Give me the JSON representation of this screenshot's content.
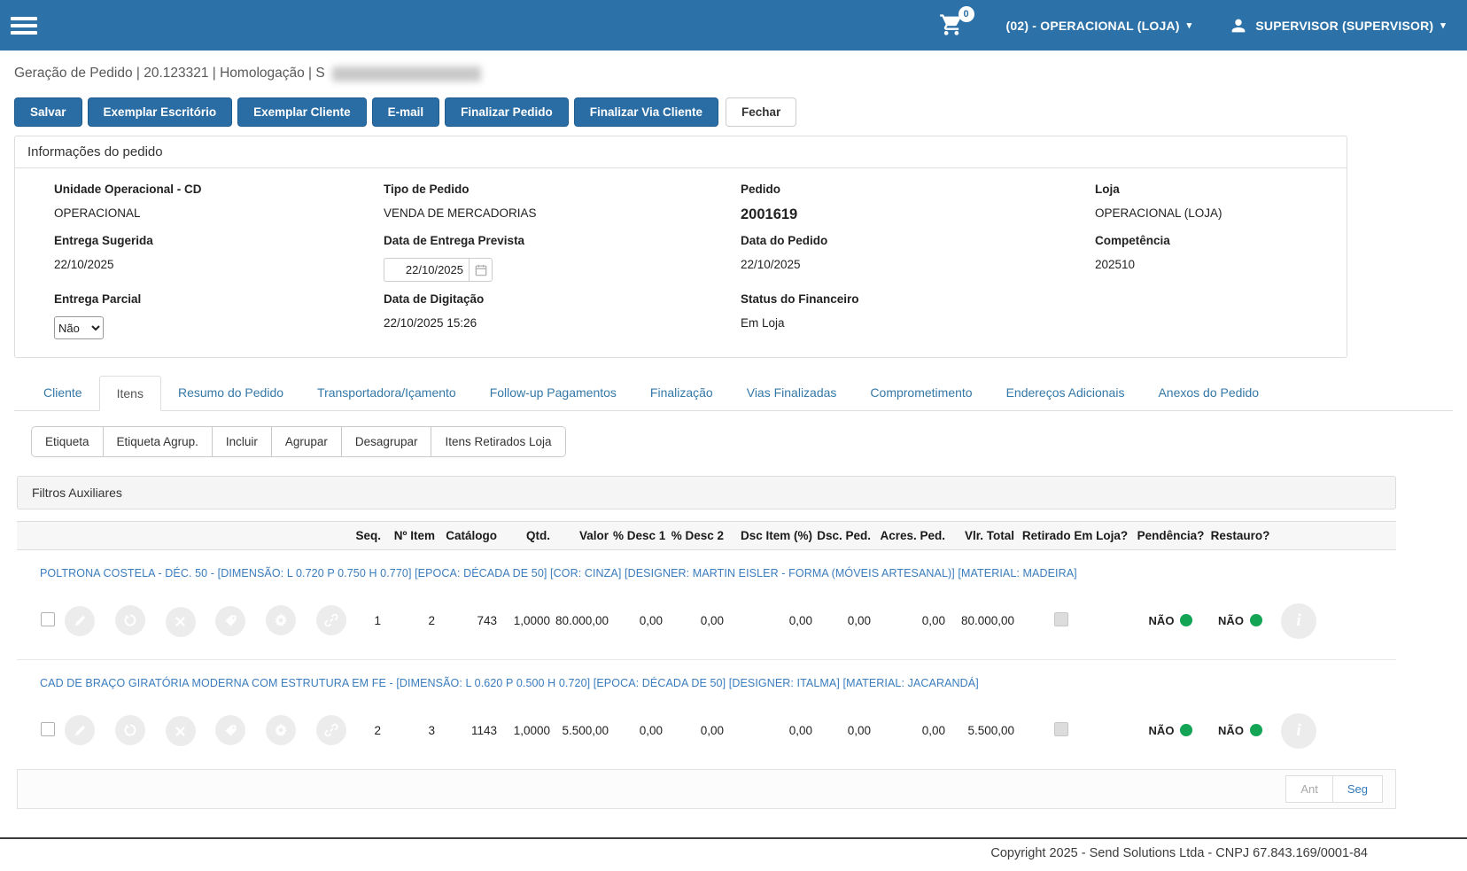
{
  "topbar": {
    "cart_count": "0",
    "unit_label": "(02) - OPERACIONAL (LOJA)",
    "user_label": "SUPERVISOR (SUPERVISOR)",
    "caret": "▾"
  },
  "header": {
    "title": "Geração de Pedido | 20.123321 | Homologação | S"
  },
  "toolbar": {
    "save": "Salvar",
    "office_copy": "Exemplar Escritório",
    "client_copy": "Exemplar Cliente",
    "email": "E-mail",
    "finalize_order": "Finalizar Pedido",
    "finalize_via_client": "Finalizar Via Cliente",
    "close": "Fechar"
  },
  "info_panel": {
    "title": "Informações do pedido",
    "fields": {
      "unit": {
        "label": "Unidade Operacional - CD",
        "value": "OPERACIONAL"
      },
      "order_type": {
        "label": "Tipo de Pedido",
        "value": "VENDA DE MERCADORIAS"
      },
      "order": {
        "label": "Pedido",
        "value": "2001619"
      },
      "store": {
        "label": "Loja",
        "value": "OPERACIONAL (LOJA)"
      },
      "suggested_delivery": {
        "label": "Entrega Sugerida",
        "value": "22/10/2025"
      },
      "expected_delivery": {
        "label": "Data de Entrega Prevista",
        "value": "22/10/2025"
      },
      "order_date": {
        "label": "Data do Pedido",
        "value": "22/10/2025"
      },
      "competence": {
        "label": "Competência",
        "value": "202510"
      },
      "partial_delivery": {
        "label": "Entrega Parcial",
        "value": "Não"
      },
      "typing_date": {
        "label": "Data de Digitação",
        "value": "22/10/2025 15:26"
      },
      "financial_status": {
        "label": "Status do Financeiro",
        "value": "Em Loja"
      }
    }
  },
  "tabs": [
    {
      "label": "Cliente"
    },
    {
      "label": "Itens",
      "active": true
    },
    {
      "label": "Resumo do Pedido"
    },
    {
      "label": "Transportadora/Içamento"
    },
    {
      "label": "Follow-up Pagamentos"
    },
    {
      "label": "Finalização"
    },
    {
      "label": "Vias Finalizadas"
    },
    {
      "label": "Comprometimento"
    },
    {
      "label": "Endereços Adicionais"
    },
    {
      "label": "Anexos do Pedido"
    }
  ],
  "items_toolbar": [
    "Etiqueta",
    "Etiqueta Agrup.",
    "Incluir",
    "Agrupar",
    "Desagrupar",
    "Itens Retirados Loja"
  ],
  "filters": {
    "title": "Filtros Auxiliares"
  },
  "table": {
    "columns": [
      "Seq.",
      "Nº Item",
      "Catálogo",
      "Qtd.",
      "Valor",
      "% Desc 1",
      "% Desc 2",
      "Dsc Item (%)",
      "Dsc. Ped.",
      "Acres. Ped.",
      "Vlr. Total",
      "Retirado Em Loja?",
      "Pendência?",
      "Restauro?"
    ],
    "rows": [
      {
        "description": "POLTRONA COSTELA - DÉC. 50 - [DIMENSÃO: L 0.720 P 0.750 H 0.770] [EPOCA: DÉCADA DE 50] [COR: CINZA] [DESIGNER: MARTIN EISLER - FORMA (MÓVEIS ARTESANAL)] [MATERIAL: MADEIRA]",
        "values": [
          "1",
          "2",
          "743",
          "1,0000",
          "80.000,00",
          "0,00",
          "0,00",
          "0,00",
          "0,00",
          "0,00",
          "80.000,00"
        ],
        "pendencia": "NÃO",
        "restauro": "NÃO"
      },
      {
        "description": "CAD DE BRAÇO GIRATÓRIA MODERNA COM ESTRUTURA EM FE - [DIMENSÃO: L 0.620 P 0.500 H 0.720] [EPOCA: DÉCADA DE 50] [DESIGNER: ITALMA] [MATERIAL: JACARANDÁ]",
        "values": [
          "2",
          "3",
          "1143",
          "1,0000",
          "5.500,00",
          "0,00",
          "0,00",
          "0,00",
          "0,00",
          "0,00",
          "5.500,00"
        ],
        "pendencia": "NÃO",
        "restauro": "NÃO"
      }
    ]
  },
  "pagination": {
    "prev": "Ant",
    "next": "Seg"
  },
  "footer": {
    "text": "Copyright 2025 - Send Solutions Ltda - CNPJ 67.843.169/0001-84"
  },
  "icons": {
    "row_actions": [
      "edit-icon",
      "history-icon",
      "remove-icon",
      "tag-icon",
      "gear-icon",
      "link-icon"
    ],
    "info": "info-icon"
  },
  "colors": {
    "topbar_blue": "#2C72A8",
    "button_blue": "#2A6DA4",
    "link_blue": "#3A7CBD",
    "status_green": "#13A456"
  }
}
